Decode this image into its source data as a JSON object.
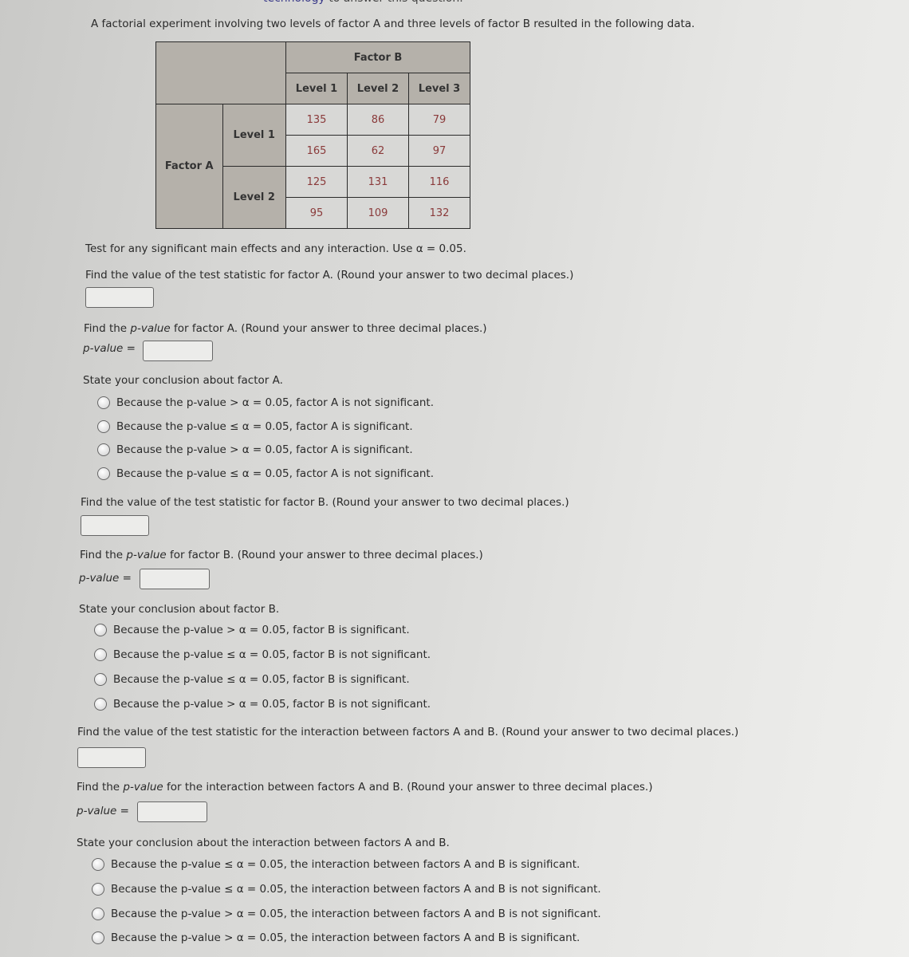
{
  "header": {
    "clipped_text_link": "technology",
    "clipped_text_rest": " to answer this question."
  },
  "intro": "A factorial experiment involving two levels of factor A and three levels of factor B resulted in the following data.",
  "table": {
    "factor_b_label": "Factor B",
    "factor_a_label": "Factor A",
    "b_levels": [
      "Level 1",
      "Level 2",
      "Level 3"
    ],
    "a_levels": [
      "Level 1",
      "Level 2"
    ],
    "rows": [
      [
        "135",
        "86",
        "79"
      ],
      [
        "165",
        "62",
        "97"
      ],
      [
        "125",
        "131",
        "116"
      ],
      [
        "95",
        "109",
        "132"
      ]
    ]
  },
  "instructions": "Test for any significant main effects and any interaction. Use α = 0.05.",
  "sections": {
    "a_stat_prompt": "Find the value of the test statistic for factor A. (Round your answer to two decimal places.)",
    "a_p_prompt_pre": "Find the ",
    "a_p_prompt_post": " for factor A. (Round your answer to three decimal places.)",
    "p_word": "p-value",
    "p_label_post": " =",
    "a_conclusion_prompt": "State your conclusion about factor A.",
    "a_options": [
      "Because the p-value > α = 0.05, factor A is not significant.",
      "Because the p-value ≤ α = 0.05, factor A is significant.",
      "Because the p-value > α = 0.05, factor A is significant.",
      "Because the p-value ≤ α = 0.05, factor A is not significant."
    ],
    "b_stat_prompt": "Find the value of the test statistic for factor B. (Round your answer to two decimal places.)",
    "b_p_prompt_post": " for factor B. (Round your answer to three decimal places.)",
    "b_conclusion_prompt": "State your conclusion about factor B.",
    "b_options": [
      "Because the p-value > α = 0.05, factor B is significant.",
      "Because the p-value ≤ α = 0.05, factor B is not significant.",
      "Because the p-value ≤ α = 0.05, factor B is significant.",
      "Because the p-value > α = 0.05, factor B is not significant."
    ],
    "ab_stat_prompt": "Find the value of the test statistic for the interaction between factors A and B. (Round your answer to two decimal places.)",
    "ab_p_prompt_post": " for the interaction between factors A and B. (Round your answer to three decimal places.)",
    "ab_conclusion_prompt": "State your conclusion about the interaction between factors A and B.",
    "ab_options": [
      "Because the p-value ≤ α = 0.05, the interaction between factors A and B is significant.",
      "Because the p-value ≤ α = 0.05, the interaction between factors A and B is not significant.",
      "Because the p-value > α = 0.05, the interaction between factors A and B is not significant.",
      "Because the p-value > α = 0.05, the interaction between factors A and B is significant."
    ]
  },
  "inputs": {
    "a_stat_value": "",
    "a_p_value": "",
    "b_stat_value": "",
    "b_p_value": "",
    "ab_stat_value": "",
    "ab_p_value": ""
  }
}
